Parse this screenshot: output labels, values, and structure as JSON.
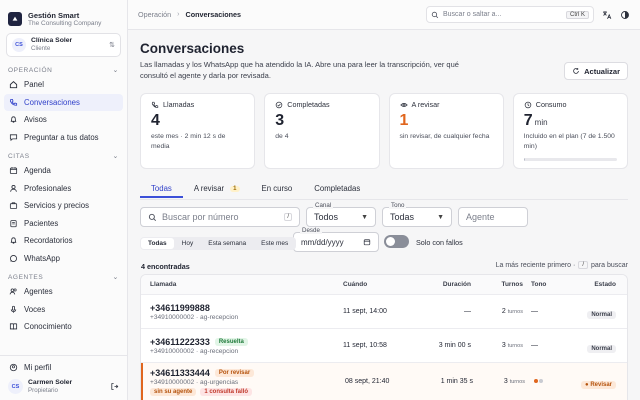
{
  "brand": {
    "name": "Gestión Smart",
    "sub": "The Consulting Company"
  },
  "client": {
    "initials": "CS",
    "name": "Clínica Soler",
    "role": "Cliente"
  },
  "sections": {
    "operacion": "OPERACIÓN",
    "citas": "CITAS",
    "agentes": "AGENTES"
  },
  "nav": {
    "panel": "Panel",
    "conversaciones": "Conversaciones",
    "avisos": "Avisos",
    "preguntar": "Preguntar a tus datos",
    "agenda": "Agenda",
    "profesionales": "Profesionales",
    "servicios": "Servicios y precios",
    "pacientes": "Pacientes",
    "recordatorios": "Recordatorios",
    "whatsapp": "WhatsApp",
    "agentes": "Agentes",
    "voces": "Voces",
    "conocimiento": "Conocimiento"
  },
  "bottom": {
    "perfil": "Mi perfil",
    "user_initials": "CS",
    "user_name": "Carmen Soler",
    "user_role": "Propietario"
  },
  "topbar": {
    "crumb1": "Operación",
    "crumb2": "Conversaciones",
    "search_placeholder": "Buscar o saltar a...",
    "search_kbd": "Ctrl K"
  },
  "page": {
    "title": "Conversaciones",
    "desc": "Las llamadas y los WhatsApp que ha atendido la IA. Abre una para leer la transcripción, ver qué consultó el agente y darla por revisada.",
    "refresh": "Actualizar"
  },
  "cards": [
    {
      "label": "Llamadas",
      "value": "4",
      "unit": "",
      "sub": "este mes · 2 min 12 s de media"
    },
    {
      "label": "Completadas",
      "value": "3",
      "unit": "",
      "sub": "de 4"
    },
    {
      "label": "A revisar",
      "value": "1",
      "unit": "",
      "sub": "sin revisar, de cualquier fecha"
    },
    {
      "label": "Consumo",
      "value": "7",
      "unit": "min",
      "sub": "Incluido en el plan (7 de 1.500 min)",
      "progress": 0.0047
    }
  ],
  "tabs": {
    "todas": "Todas",
    "revisar": "A revisar",
    "revisar_count": "1",
    "curso": "En curso",
    "completadas": "Completadas"
  },
  "filters": {
    "search_placeholder": "Buscar por número",
    "search_kbd": "/",
    "canal_label": "Canal",
    "canal_value": "Todos",
    "tono_label": "Tono",
    "tono_value": "Todas",
    "agente_placeholder": "Agente",
    "desde_label": "Desde",
    "desde_value": "mm/dd/yyyy",
    "chips": [
      "Todas",
      "Hoy",
      "Esta semana",
      "Este mes"
    ],
    "toggle_label": "Solo con fallos"
  },
  "list": {
    "found": "4 encontradas",
    "sort_text": "La más reciente primero ·",
    "sort_kbd": "/",
    "sort_suffix": "para buscar"
  },
  "table": {
    "headers": [
      "Llamada",
      "Cuándo",
      "Duración",
      "Turnos",
      "Tono",
      "Estado"
    ],
    "rows": [
      {
        "number": "+34611999888",
        "meta": "+34910000002 · ag-recepcion",
        "badge": "",
        "when": "11 sept, 14:00",
        "dur": "—",
        "turns": "2",
        "turns_unit": "turnos",
        "tone": "—",
        "state": "Normal"
      },
      {
        "number": "+34611222333",
        "meta": "+34910000002 · ag-recepcion",
        "badge": "Resuelta",
        "when": "11 sept, 10:58",
        "dur": "3 min 00 s",
        "turns": "3",
        "turns_unit": "turnos",
        "tone": "—",
        "state": "Normal"
      },
      {
        "number": "+34611333444",
        "meta": "+34910000002 · ag-urgencias",
        "badge": "Por revisar",
        "tag1": "sin su agente",
        "tag2": "1 consulta falló",
        "when": "08 sept, 21:40",
        "dur": "1 min 35 s",
        "turns": "3",
        "turns_unit": "turnos",
        "state": "Revisar"
      }
    ]
  }
}
